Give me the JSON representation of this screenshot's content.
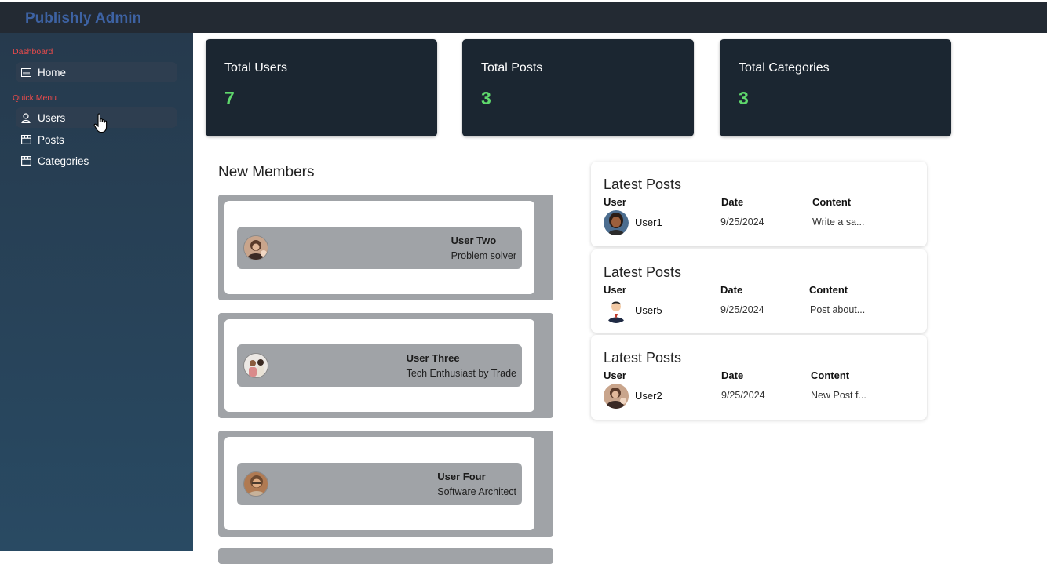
{
  "app": {
    "title": "Publishly Admin"
  },
  "sidebar": {
    "sections": [
      {
        "label": "Dashboard"
      },
      {
        "label": "Quick Menu"
      }
    ],
    "items": [
      {
        "label": "Home",
        "icon": "dashboard-icon"
      },
      {
        "label": "Users",
        "icon": "user-icon"
      },
      {
        "label": "Posts",
        "icon": "store-icon"
      },
      {
        "label": "Categories",
        "icon": "store-icon"
      }
    ]
  },
  "stats": [
    {
      "label": "Total Users",
      "value": "7"
    },
    {
      "label": "Total Posts",
      "value": "3"
    },
    {
      "label": "Total Categories",
      "value": "3"
    }
  ],
  "new_members": {
    "title": "New Members",
    "members": [
      {
        "name": "User Two",
        "role": "Problem solver"
      },
      {
        "name": "User Three",
        "role": "Tech Enthusiast by Trade"
      },
      {
        "name": "User Four",
        "role": "Software Architect"
      }
    ]
  },
  "latest_posts": [
    {
      "title": "Latest Posts",
      "col_user": "User",
      "col_date": "Date",
      "col_content": "Content",
      "user": "User1",
      "date": "9/25/2024",
      "content": "Write a sa..."
    },
    {
      "title": "Latest Posts",
      "col_user": "User",
      "col_date": "Date",
      "col_content": "Content",
      "user": "User5",
      "date": "9/25/2024",
      "content": "Post about..."
    },
    {
      "title": "Latest Posts",
      "col_user": "User",
      "col_date": "Date",
      "col_content": "Content",
      "user": "User2",
      "date": "9/25/2024",
      "content": "New Post f..."
    }
  ],
  "colors": {
    "topbar": "#232a33",
    "brand": "#3d62a3",
    "sidebar": "#294a63",
    "section_label": "#ec4b4b",
    "card_bg": "#1b2631",
    "stat_value": "#5fd86c",
    "member_frame": "#a0a3a7"
  }
}
